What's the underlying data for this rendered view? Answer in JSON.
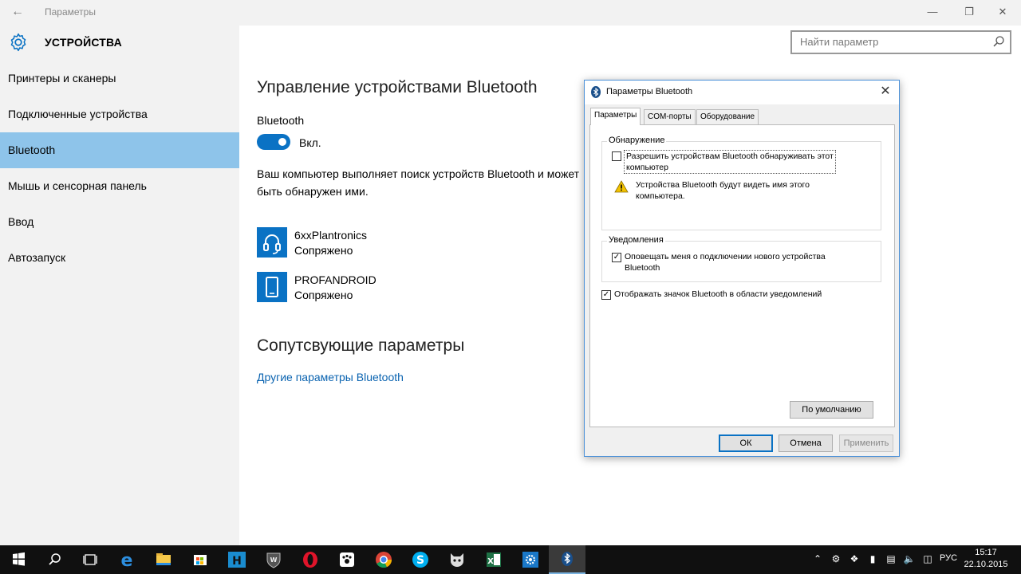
{
  "window": {
    "title": "Параметры",
    "back_icon": "back-arrow-icon",
    "minimize_icon": "minimize-icon",
    "maximize_icon": "restore-icon",
    "close_icon": "close-icon"
  },
  "header": {
    "icon": "gear-icon",
    "title": "УСТРОЙСТВА"
  },
  "search": {
    "placeholder": "Найти параметр",
    "icon": "search-icon"
  },
  "sidebar": {
    "items": [
      {
        "label": "Принтеры и сканеры",
        "selected": false
      },
      {
        "label": "Подключенные устройства",
        "selected": false
      },
      {
        "label": "Bluetooth",
        "selected": true
      },
      {
        "label": "Мышь и сенсорная панель",
        "selected": false
      },
      {
        "label": "Ввод",
        "selected": false
      },
      {
        "label": "Автозапуск",
        "selected": false
      }
    ]
  },
  "main": {
    "heading": "Управление устройствами Bluetooth",
    "bluetooth_label": "Bluetooth",
    "toggle_state": "Вкл.",
    "toggle_on": true,
    "description_line1": "Ваш компьютер выполняет поиск устройств Bluetooth и может",
    "description_line2": "быть обнаружен ими.",
    "devices": [
      {
        "name": "6xxPlantronics",
        "status": "Сопряжено",
        "icon": "headset-icon"
      },
      {
        "name": "PROFANDROID",
        "status": "Сопряжено",
        "icon": "phone-icon"
      }
    ],
    "related_heading": "Сопутсвующие параметры",
    "related_link": "Другие параметры Bluetooth"
  },
  "dialog": {
    "title": "Параметры Bluetooth",
    "icon": "bluetooth-icon",
    "tabs": [
      {
        "label": "Параметры",
        "active": true
      },
      {
        "label": "COM-порты",
        "active": false
      },
      {
        "label": "Оборудование",
        "active": false
      }
    ],
    "discovery": {
      "group_title": "Обнаружение",
      "checkbox_label_line1": "Разрешить устройствам Bluetooth обнаруживать этот",
      "checkbox_label_line2": "компьютер",
      "checked": false,
      "warning_line1": "Устройства Bluetooth будут видеть имя этого",
      "warning_line2": "компьютера.",
      "warning_icon": "warning-icon"
    },
    "notifications": {
      "group_title": "Уведомления",
      "checkbox_label_line1": "Оповещать меня о подключении нового устройства",
      "checkbox_label_line2": "Bluetooth",
      "checked": true
    },
    "tray_icon_option": {
      "label": "Отображать значок Bluetooth в области уведомлений",
      "checked": true
    },
    "default_button": "По умолчанию",
    "ok_button": "ОК",
    "cancel_button": "Отмена",
    "apply_button": "Применить"
  },
  "taskbar": {
    "items": [
      {
        "name": "start-icon"
      },
      {
        "name": "search-icon"
      },
      {
        "name": "task-view-icon"
      },
      {
        "name": "edge-icon"
      },
      {
        "name": "file-explorer-icon"
      },
      {
        "name": "store-icon"
      },
      {
        "name": "hd-app-icon"
      },
      {
        "name": "world-of-tanks-icon"
      },
      {
        "name": "opera-icon"
      },
      {
        "name": "paw-app-icon"
      },
      {
        "name": "chrome-icon"
      },
      {
        "name": "skype-icon"
      },
      {
        "name": "bug-app-icon"
      },
      {
        "name": "excel-icon"
      },
      {
        "name": "settings-icon"
      },
      {
        "name": "bluetooth-icon"
      }
    ],
    "language": "РУС",
    "time": "15:17",
    "date": "22.10.2015"
  },
  "colors": {
    "accent": "#0a72c4",
    "selected_nav": "#8ec4ea",
    "link": "#0a63b0",
    "taskbar": "#101010"
  }
}
